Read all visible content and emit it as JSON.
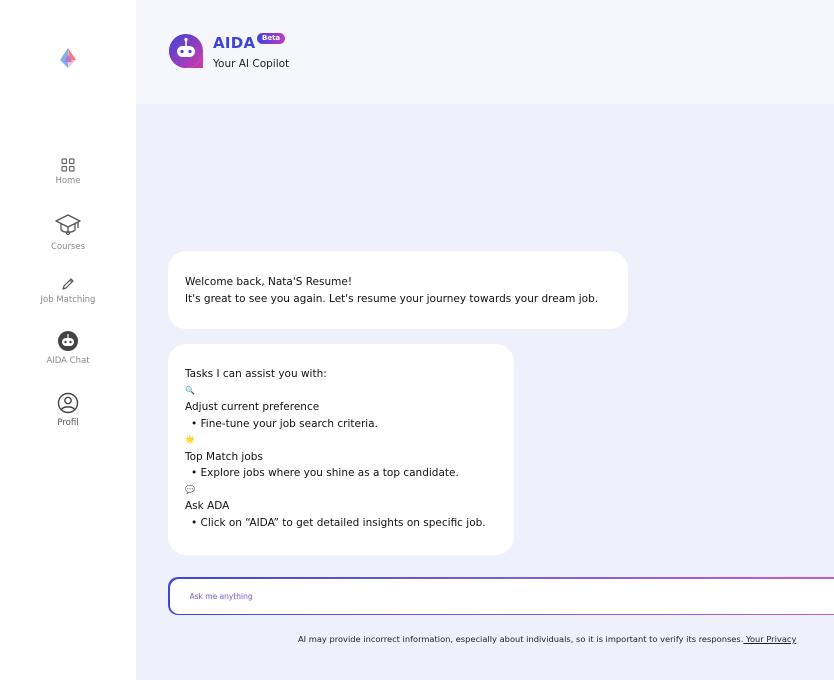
{
  "sidebar": {
    "items": [
      {
        "label": "Home",
        "icon": "grid-icon"
      },
      {
        "label": "Courses",
        "icon": "graduation-cap-icon"
      },
      {
        "label": "Job Matching",
        "icon": "pencil-icon"
      },
      {
        "label": "AIDA Chat",
        "icon": "chat-bot-icon"
      },
      {
        "label": "Profil",
        "icon": "user-circle-icon"
      }
    ]
  },
  "header": {
    "title": "AIDA",
    "badge": "Beta",
    "subtitle": "Your AI Copilot"
  },
  "chat": {
    "welcome": {
      "line1": "Welcome back, Nata'S Resume!",
      "line2": "It's great to see you again. Let's resume your journey towards your dream job."
    },
    "tasks": {
      "intro": "Tasks I can assist you with:",
      "items": [
        {
          "emoji": "🔍",
          "title": "Adjust current preference",
          "detail": "• Fine-tune your job search criteria."
        },
        {
          "emoji": "🌟",
          "title": "Top Match jobs",
          "detail": "• Explore jobs where you shine as a top candidate."
        },
        {
          "emoji": "💬",
          "title": "Ask ADA",
          "detail": "• Click on “AIDA” to get detailed insights on specific job."
        }
      ]
    }
  },
  "input": {
    "placeholder": "Ask me anything"
  },
  "footer": {
    "disclaimer": "AI may provide incorrect information, especially about individuals, so it is important to verify its responses.",
    "privacy_link": " Your Privacy"
  },
  "colors": {
    "accent": "#3d44d6",
    "accent2": "#c23ac7",
    "background": "#eef0fc"
  }
}
